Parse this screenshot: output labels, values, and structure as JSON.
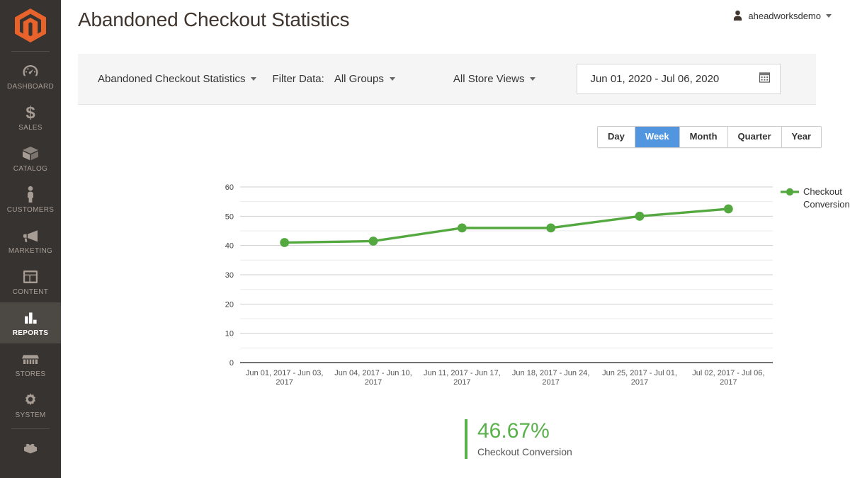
{
  "brand": {
    "logo_name": "magento-logo",
    "logo_color": "#E8632B"
  },
  "sidebar": {
    "items": [
      {
        "label": "DASHBOARD",
        "icon": "dashboard-gauge-icon",
        "active": false
      },
      {
        "label": "SALES",
        "icon": "dollar-sign-icon",
        "active": false
      },
      {
        "label": "CATALOG",
        "icon": "box-icon",
        "active": false
      },
      {
        "label": "CUSTOMERS",
        "icon": "person-icon",
        "active": false
      },
      {
        "label": "MARKETING",
        "icon": "megaphone-icon",
        "active": false
      },
      {
        "label": "CONTENT",
        "icon": "layout-panels-icon",
        "active": false
      },
      {
        "label": "REPORTS",
        "icon": "bar-chart-icon",
        "active": true
      },
      {
        "label": "STORES",
        "icon": "storefront-icon",
        "active": false
      },
      {
        "label": "SYSTEM",
        "icon": "gear-icon",
        "active": false
      },
      {
        "label": "",
        "icon": "extensions-brick-icon",
        "active": false
      }
    ]
  },
  "header": {
    "title": "Abandoned Checkout Statistics",
    "user": {
      "name": "aheadworksdemo",
      "avatar_icon": "user-avatar-icon",
      "caret_icon": "chevron-down-icon"
    }
  },
  "filter_bar": {
    "report_select": "Abandoned Checkout Statistics",
    "filter_data_label": "Filter Data:",
    "group_select": "All Groups",
    "store_view_select": "All Store Views",
    "date_range": "Jun 01, 2020  -  Jul 06, 2020",
    "calendar_icon": "calendar-icon"
  },
  "period_toggle": {
    "options": [
      "Day",
      "Week",
      "Month",
      "Quarter",
      "Year"
    ],
    "active": "Week",
    "active_color": "#5396e0"
  },
  "summary": {
    "value": "46.67%",
    "label": "Checkout Conversion",
    "accent_color": "#5ab14c"
  },
  "chart_data": {
    "type": "line",
    "title": "",
    "xlabel": "",
    "ylabel": "",
    "ylim": [
      0,
      60
    ],
    "yticks": [
      0,
      10,
      20,
      30,
      40,
      50,
      60
    ],
    "minor_gridlines": [
      5,
      15,
      25,
      35,
      45,
      55
    ],
    "grid": true,
    "legend_position": "right",
    "series": [
      {
        "name": "Checkout Conversion",
        "color": "#53a93f",
        "values": [
          41,
          41.5,
          46,
          46,
          50,
          52.5
        ]
      }
    ],
    "categories": [
      "Jun 01, 2017 - Jun 03, 2017",
      "Jun 04, 2017 - Jun 10, 2017",
      "Jun 11, 2017 - Jun 17, 2017",
      "Jun 18, 2017 - Jun 24, 2017",
      "Jun 25, 2017 - Jul 01, 2017",
      "Jul 02, 2017 - Jul 06, 2017"
    ],
    "categories_lines": [
      [
        "Jun 01, 2017 - Jun 03,",
        "2017"
      ],
      [
        "Jun 04, 2017 - Jun 10,",
        "2017"
      ],
      [
        "Jun 11, 2017 - Jun 17,",
        "2017"
      ],
      [
        "Jun 18, 2017 - Jun 24,",
        "2017"
      ],
      [
        "Jun 25, 2017 - Jul 01,",
        "2017"
      ],
      [
        "Jul 02, 2017 - Jul 06,",
        "2017"
      ]
    ],
    "legend_lines": [
      "Checkout",
      "Conversion"
    ]
  }
}
